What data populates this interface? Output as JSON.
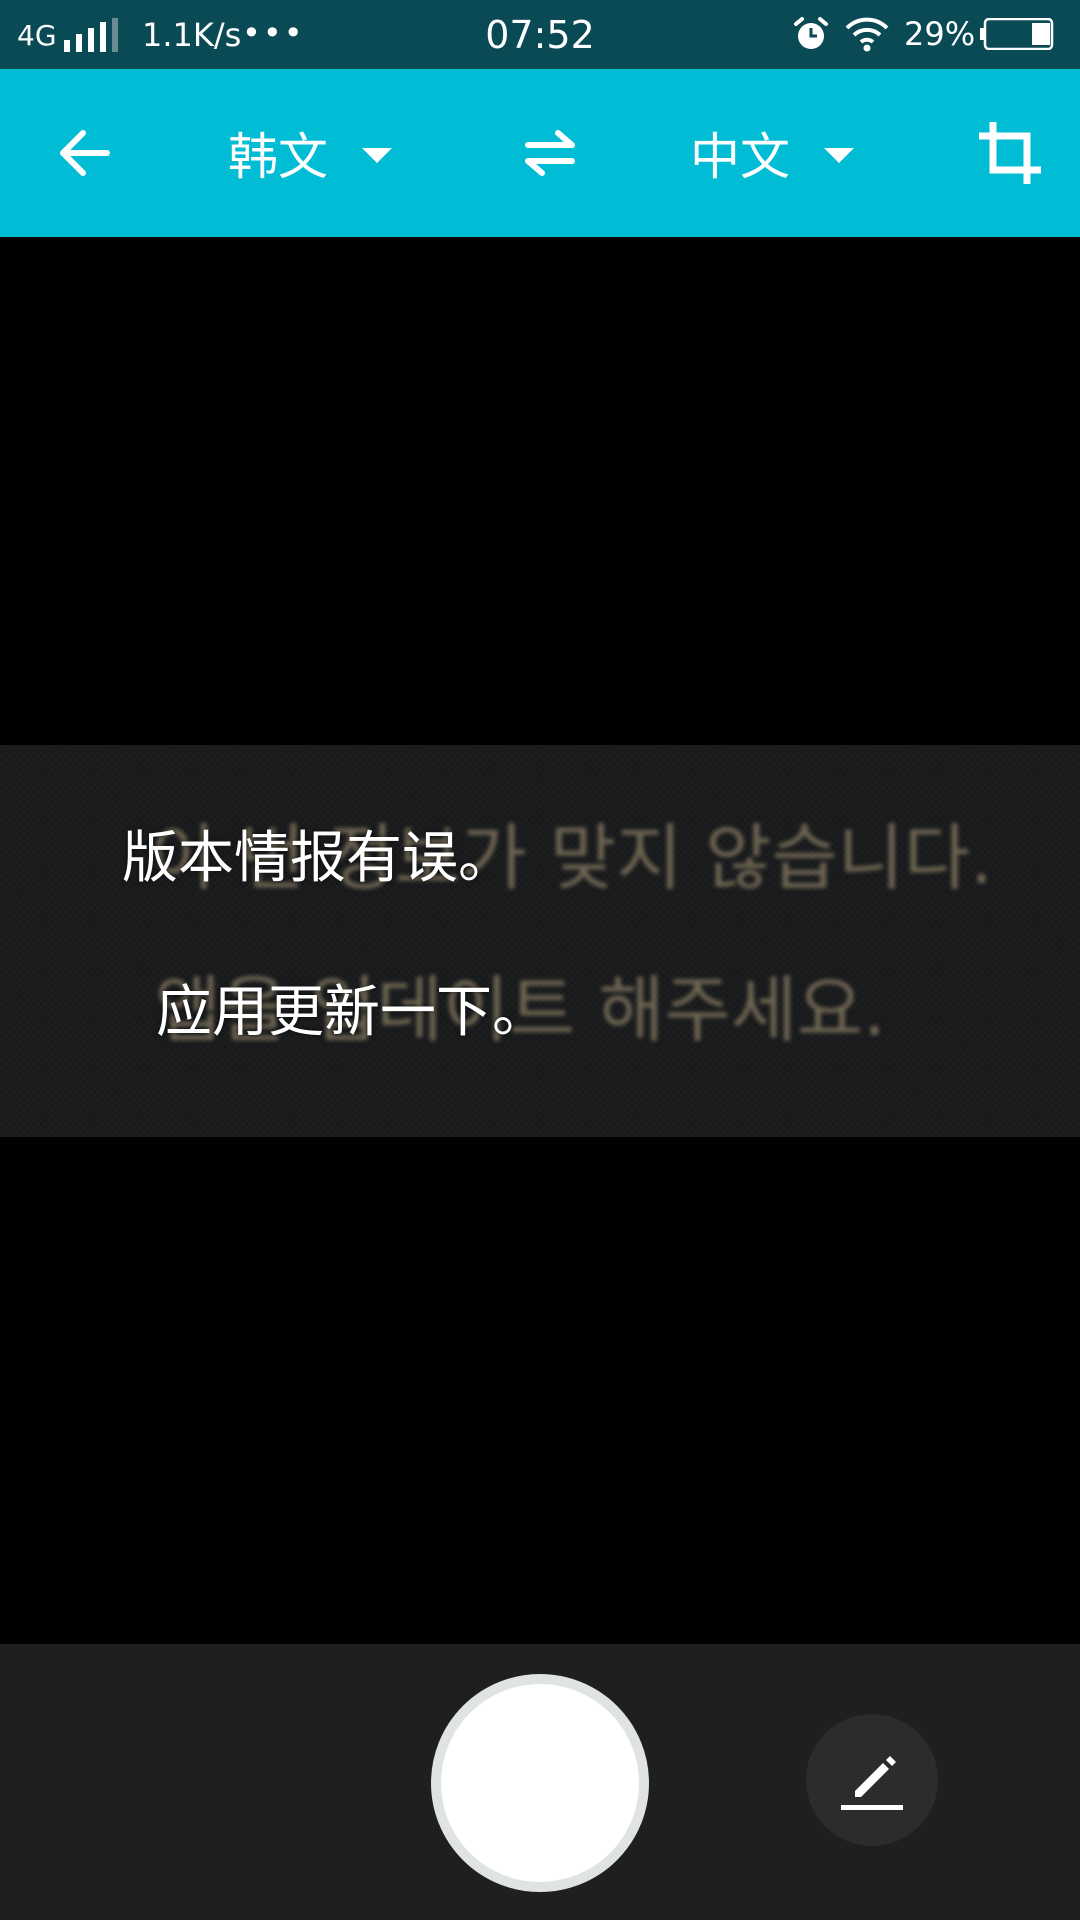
{
  "status_bar": {
    "network": "4G",
    "speed": "1.1K/s",
    "dots": "•••",
    "time": "07:52",
    "battery_percent": "29%",
    "battery_level": 0.29,
    "icons": [
      "signal-icon",
      "alarm-icon",
      "wifi-icon",
      "battery-icon"
    ]
  },
  "toolbar": {
    "source_language": "韩文",
    "target_language": "中文",
    "icons": [
      "back-arrow-icon",
      "swap-icon",
      "crop-icon",
      "dropdown-caret-icon"
    ]
  },
  "preview": {
    "source_lines": [
      "이 번 정보가 맞지 않습니다.",
      "앱을 업데이트 해주세요."
    ],
    "translated_lines": [
      "版本情报有误。",
      "应用更新一下。"
    ]
  },
  "bottom_bar": {
    "icons": [
      "shutter-button",
      "pencil-icon"
    ]
  },
  "colors": {
    "status_bar_bg": "#0a4a55",
    "toolbar_bg": "#00bcd4",
    "bottom_bar_bg": "#1f1f1f",
    "overlay_text": "#ffffff"
  }
}
